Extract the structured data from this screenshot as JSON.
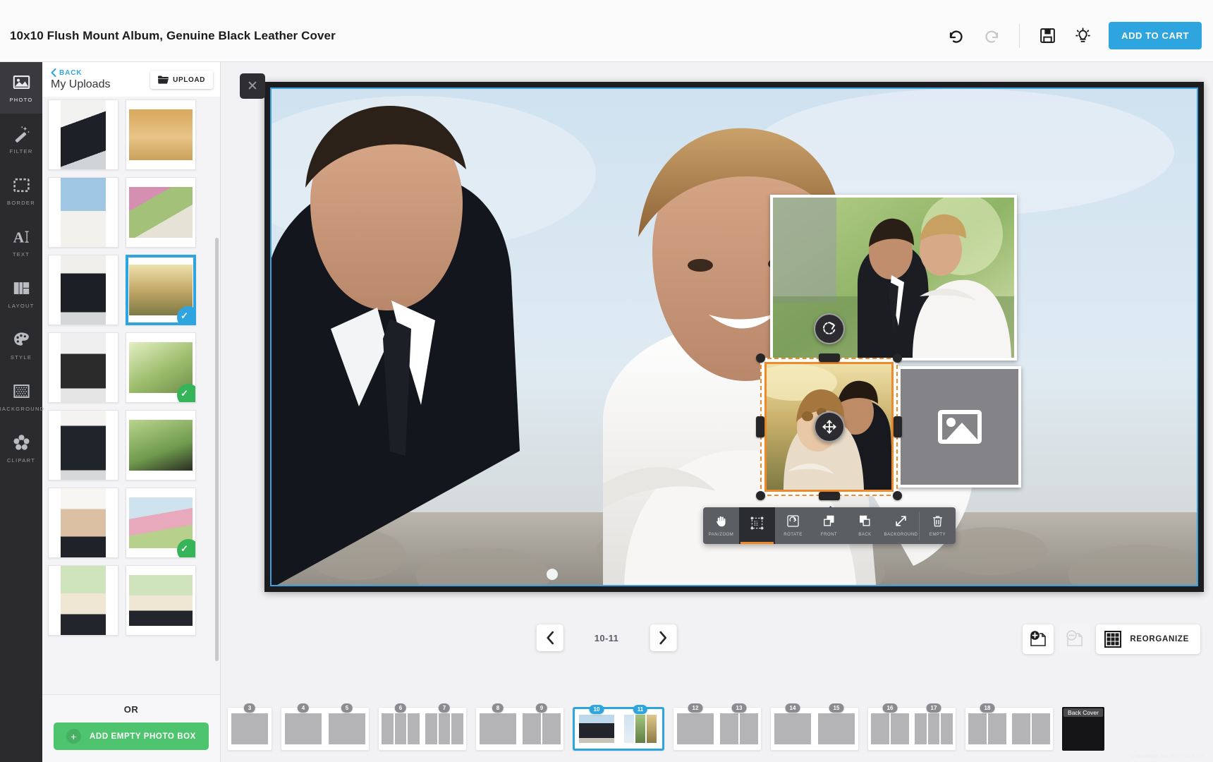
{
  "header": {
    "title": "10x10 Flush Mount Album, Genuine Black Leather Cover",
    "undo_icon": "undo-icon",
    "redo_icon": "redo-icon",
    "save_icon": "save-icon",
    "idea_icon": "lightbulb-icon",
    "add_to_cart_label": "ADD TO CART",
    "accent_color": "#2fa5e0"
  },
  "rail": {
    "items": [
      {
        "label": "PHOTO",
        "icon": "photo-icon",
        "active": true
      },
      {
        "label": "FILTER",
        "icon": "magic-wand-icon",
        "active": false
      },
      {
        "label": "BORDER",
        "icon": "border-frame-icon",
        "active": false
      },
      {
        "label": "TEXT",
        "icon": "text-cursor-icon",
        "active": false
      },
      {
        "label": "LAYOUT",
        "icon": "layout-grid-icon",
        "active": false
      },
      {
        "label": "STYLE",
        "icon": "palette-icon",
        "active": false
      },
      {
        "label": "BACKGROUND",
        "icon": "texture-swatch-icon",
        "active": false
      },
      {
        "label": "CLIPART",
        "icon": "flower-icon",
        "active": false
      }
    ]
  },
  "panel": {
    "back_label": "BACK",
    "title": "My Uploads",
    "upload_label": "UPLOAD",
    "upload_icon": "folder-icon",
    "close_icon": "close-icon",
    "or_label": "OR",
    "add_empty_label": "ADD EMPTY PHOTO BOX",
    "add_empty_icon": "plus-icon",
    "thumbnails": [
      {
        "name": "groom-adjusting-jacket",
        "used": false,
        "selected": false
      },
      {
        "name": "shoes-in-autumn-leaves",
        "used": false,
        "selected": false
      },
      {
        "name": "bride-laughing-blue-sky",
        "used": false,
        "selected": false
      },
      {
        "name": "bride-under-pink-blossoms",
        "used": false,
        "selected": false
      },
      {
        "name": "groom-portrait-boutonniere",
        "used": false,
        "selected": false
      },
      {
        "name": "couple-embrace-golden-field",
        "used": false,
        "selected": true
      },
      {
        "name": "couple-black-and-white-kiss",
        "used": false,
        "selected": false
      },
      {
        "name": "couple-in-garden-sunlight",
        "used": true,
        "selected": false
      },
      {
        "name": "groom-tying-tie",
        "used": false,
        "selected": false
      },
      {
        "name": "groom-reading-vows",
        "used": false,
        "selected": false
      },
      {
        "name": "bride-with-veil-portrait",
        "used": false,
        "selected": false
      },
      {
        "name": "couple-under-blossom-tree",
        "used": true,
        "selected": false
      },
      {
        "name": "couple-smiling-outdoors-a",
        "used": false,
        "selected": false
      },
      {
        "name": "couple-smiling-outdoors-b",
        "used": false,
        "selected": false
      }
    ]
  },
  "canvas": {
    "hero_photo_name": "bride-and-groom-beach-portrait",
    "top_photo_name": "couple-garden-portrait",
    "selected_photo_name": "couple-embrace-golden-field",
    "empty_box_label": "empty-photo-box",
    "empty_box_icon": "image-placeholder-icon",
    "rotate_handle_icon": "rotate-icon",
    "move_handle_icon": "move-icon",
    "tools": [
      {
        "label": "PAN/ZOOM",
        "icon": "hand-icon",
        "active": false
      },
      {
        "label": "",
        "icon": "transform-crop-icon",
        "active": true
      },
      {
        "label": "ROTATE",
        "icon": "rotate-icon",
        "active": false
      },
      {
        "label": "FRONT",
        "icon": "bring-to-front-icon",
        "active": false
      },
      {
        "label": "BACK",
        "icon": "send-to-back-icon",
        "active": false
      },
      {
        "label": "BACKGROUND",
        "icon": "expand-diagonal-icon",
        "active": false
      },
      {
        "label": "EMPTY",
        "icon": "trash-icon",
        "active": false
      }
    ],
    "selection_color": "#ef8a2b"
  },
  "pagenav": {
    "prev_icon": "chevron-left-icon",
    "next_icon": "chevron-right-icon",
    "current_pages": "10-11",
    "add_page_icon": "add-page-icon",
    "remove_page_icon": "remove-page-icon",
    "reorganize_label": "REORGANIZE",
    "reorganize_icon": "grid-icon"
  },
  "filmstrip": {
    "spreads": [
      {
        "numbers": [
          "3"
        ],
        "cells": [
          1
        ],
        "selected": false,
        "partial": true
      },
      {
        "numbers": [
          "4",
          "5"
        ],
        "cells": [
          1,
          1
        ],
        "selected": false
      },
      {
        "numbers": [
          "6",
          "7"
        ],
        "cells": [
          3,
          3
        ],
        "selected": false
      },
      {
        "numbers": [
          "8",
          "9"
        ],
        "cells": [
          1,
          2
        ],
        "selected": false
      },
      {
        "numbers": [
          "10",
          "11"
        ],
        "cells": [
          1,
          3
        ],
        "selected": true
      },
      {
        "numbers": [
          "12",
          "13"
        ],
        "cells": [
          1,
          2
        ],
        "selected": false
      },
      {
        "numbers": [
          "14",
          "15"
        ],
        "cells": [
          1,
          1
        ],
        "selected": false
      },
      {
        "numbers": [
          "16",
          "17"
        ],
        "cells": [
          2,
          3
        ],
        "selected": false
      },
      {
        "numbers": [
          "18"
        ],
        "cells": [
          2,
          2
        ],
        "selected": false
      },
      {
        "numbers": [],
        "cells": [],
        "selected": false,
        "back_cover_label": "Back Cover"
      }
    ]
  },
  "footnote": "© Monkeytix, Inc. 2017 - v1.0.1.2"
}
